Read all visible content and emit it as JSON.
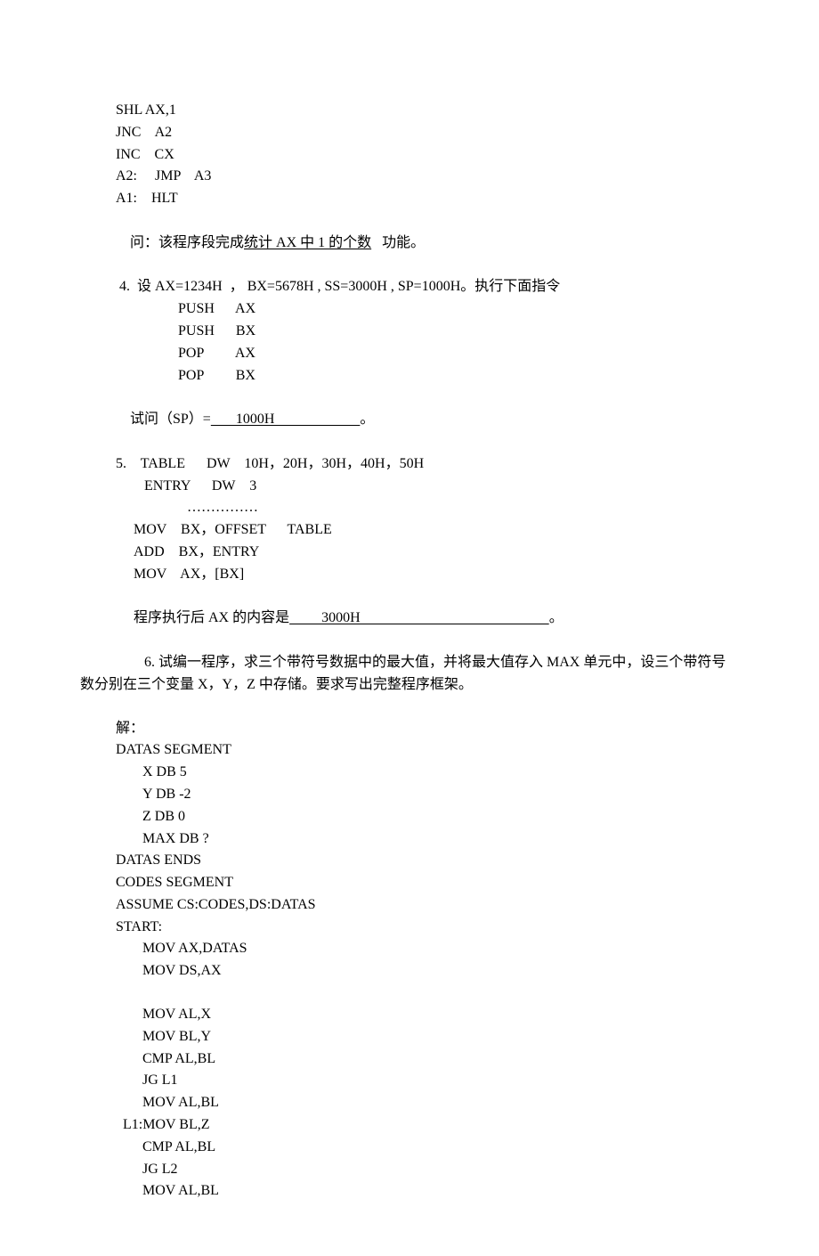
{
  "block1": {
    "l1": "SHL AX,1",
    "l2": "JNC    A2",
    "l3": "INC    CX",
    "l4": "A2:     JMP    A3",
    "l5": "A1:    HLT",
    "question_prefix": "问：该程序段完成",
    "question_underline": "统计 AX 中 1 的个数",
    "question_suffix": "   功能。"
  },
  "block2": {
    "q": " 4.  设 AX=1234H  ， BX=5678H , SS=3000H , SP=1000H。执行下面指令",
    "c1": "PUSH      AX",
    "c2": "PUSH      BX",
    "c3": "POP         AX",
    "c4": "POP         BX",
    "ans_prefix": "试问（SP）=",
    "ans_underline": "       1000H                        ",
    "ans_suffix": "。"
  },
  "block3": {
    "l1": "5.    TABLE      DW    10H，20H，30H，40H，50H",
    "l2": "ENTRY      DW    3",
    "l3": "……………",
    "l4": "MOV    BX，OFFSET      TABLE",
    "l5": "ADD    BX，ENTRY",
    "l6": "MOV    AX，[BX]",
    "ans_prefix": " 程序执行后 AX 的内容是",
    "ans_underline": "         3000H                                                     ",
    "ans_suffix": "。"
  },
  "block4": {
    "q1": "6.  试编一程序，求三个带符号数据中的最大值，并将最大值存入 MAX 单元中，设三个带符号",
    "q2": "数分别在三个变量 X，Y，Z 中存储。要求写出完整程序框架。",
    "ans_label": "解："
  },
  "code": {
    "l1": "DATAS SEGMENT",
    "l2": "X DB 5",
    "l3": "Y DB -2",
    "l4": "Z DB 0",
    "l5": "MAX DB ?",
    "l6": "DATAS ENDS",
    "l7": "CODES SEGMENT",
    "l8": "ASSUME CS:CODES,DS:DATAS",
    "l9": "START:",
    "l10": "MOV AX,DATAS",
    "l11": "MOV DS,AX",
    "l13": "MOV AL,X",
    "l14": "MOV BL,Y",
    "l15": "CMP AL,BL",
    "l16": "JG L1",
    "l17": "MOV AL,BL",
    "l18": "  L1:MOV BL,Z",
    "l19": "CMP AL,BL",
    "l20": "JG L2",
    "l21": "MOV AL,BL"
  }
}
